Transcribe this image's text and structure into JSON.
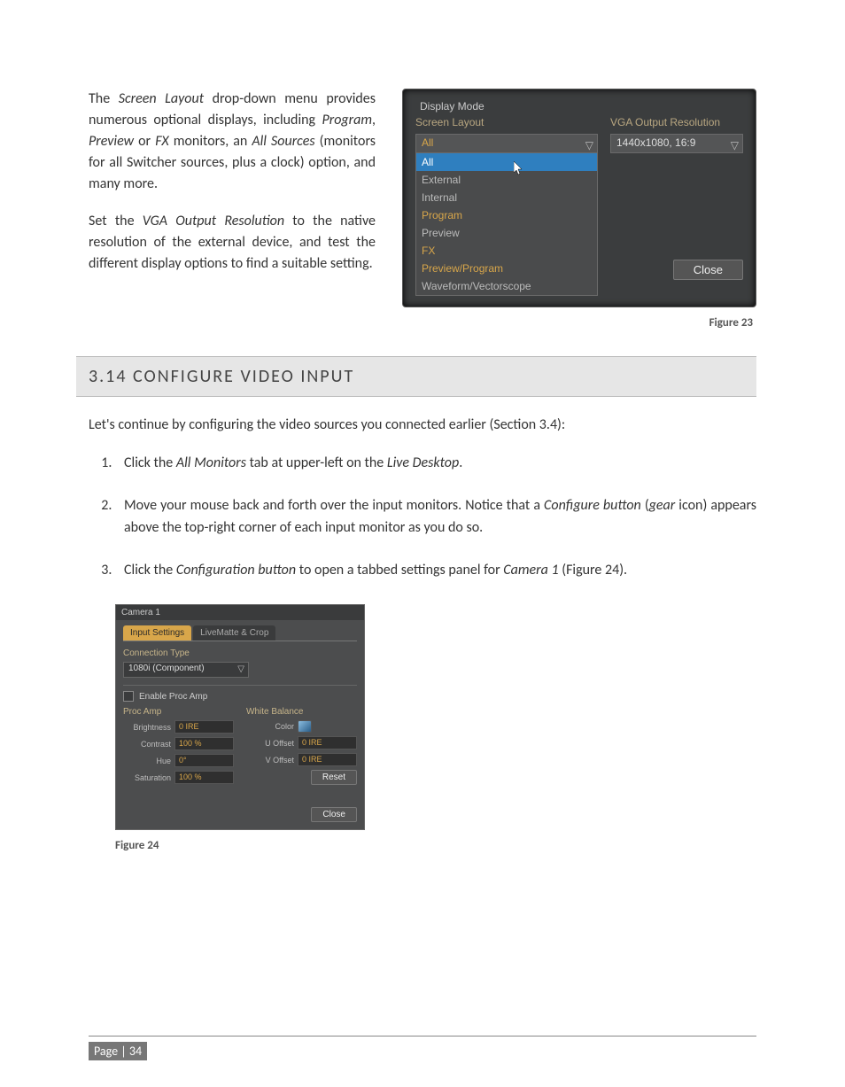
{
  "intro_paragraph_1": "The Screen Layout drop-down menu provides numerous optional displays, including Program, Preview or FX monitors, an All Sources (monitors for all Switcher sources, plus a clock) option, and many more.",
  "intro_paragraph_2": "Set the VGA Output Resolution to the native resolution of the external device, and test the different display options to find a suitable setting.",
  "figure23_caption": "Figure 23",
  "section_heading": "3.14  CONFIGURE VIDEO INPUT",
  "section_intro": "Let's continue by configuring the video sources you connected earlier (Section 3.4):",
  "steps": [
    "Click the All Monitors tab at upper-left on the Live Desktop.",
    "Move your mouse back and forth over the input monitors. Notice that a Configure button (gear icon) appears above the top-right corner of each input monitor as you do so.",
    "Click the Configuration button to open a tabbed settings panel for Camera 1 (Figure 24)."
  ],
  "figure24_caption": "Figure 24",
  "page_label": "Page | 34",
  "display_mode": {
    "legend": "Display Mode",
    "screen_layout_label": "Screen Layout",
    "vga_label": "VGA Output Resolution",
    "selected": "All",
    "options": [
      "All",
      "External",
      "Internal",
      "Program",
      "Preview",
      "FX",
      "Preview/Program",
      "Waveform/Vectorscope"
    ],
    "vga_value": "1440x1080, 16:9",
    "close_label": "Close"
  },
  "camera": {
    "title": "Camera 1",
    "tab_input": "Input Settings",
    "tab_livematte": "LiveMatte & Crop",
    "connection_type_label": "Connection Type",
    "connection_type_value": "1080i (Component)",
    "enable_proc_amp": "Enable Proc Amp",
    "proc_amp_heading": "Proc Amp",
    "white_balance_heading": "White Balance",
    "brightness_label": "Brightness",
    "brightness_value": "0 IRE",
    "contrast_label": "Contrast",
    "contrast_value": "100 %",
    "hue_label": "Hue",
    "hue_value": "0°",
    "saturation_label": "Saturation",
    "saturation_value": "100 %",
    "color_label": "Color",
    "u_offset_label": "U Offset",
    "u_offset_value": "0 IRE",
    "v_offset_label": "V Offset",
    "v_offset_value": "0 IRE",
    "reset_label": "Reset",
    "close_label": "Close"
  }
}
